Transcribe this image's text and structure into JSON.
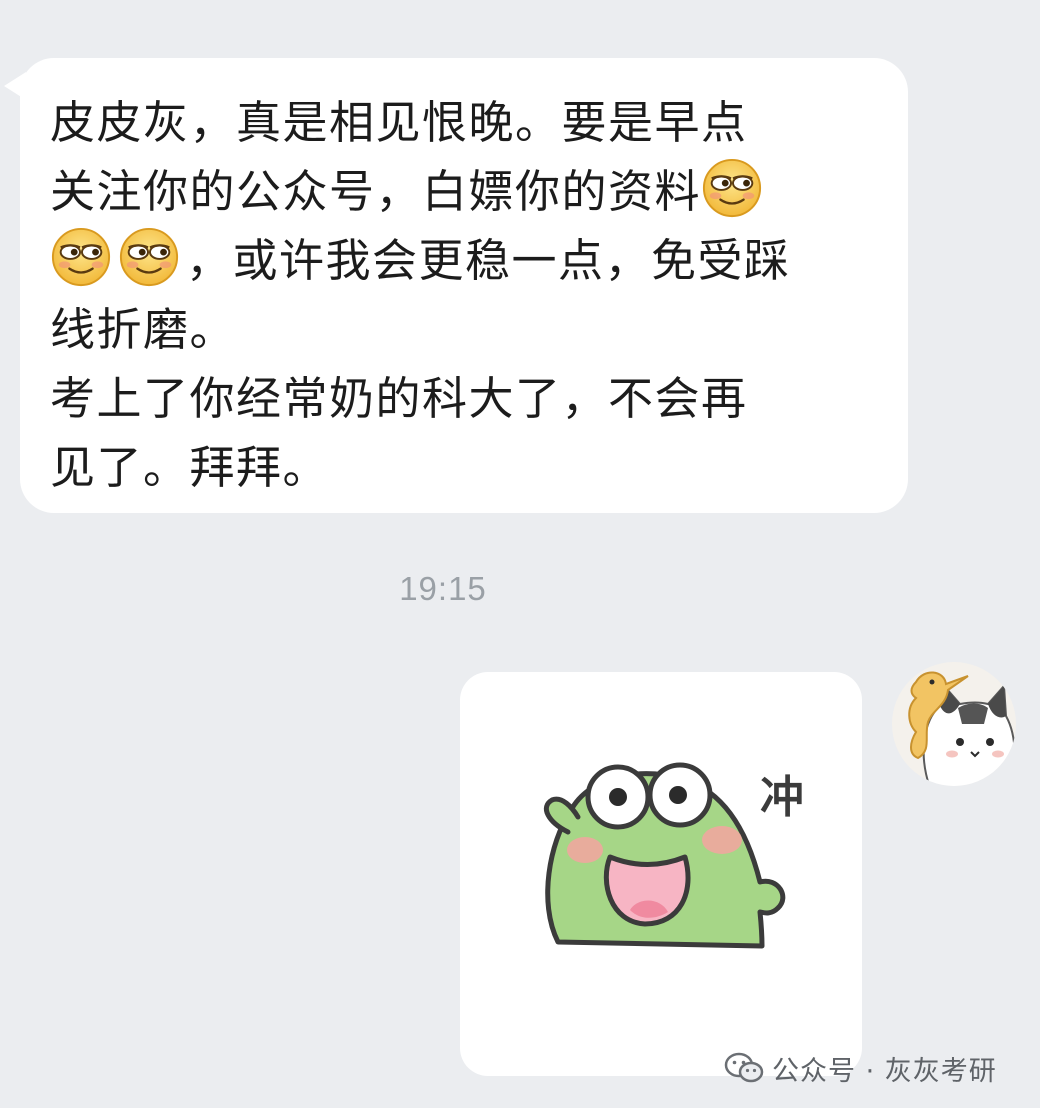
{
  "incoming_message": {
    "lines": [
      "皮皮灰，真是相见恨晚。要是早点",
      "关注你的公众号，白嫖你的资料",
      "，或许我会更稳一点，免受踩",
      "线折磨。",
      "考上了你经常奶的科大了，不会再",
      "见了。拜拜。"
    ],
    "emojis": [
      "smirk-emoji",
      "smirk-emoji",
      "smirk-emoji"
    ]
  },
  "timestamp": "19:15",
  "outgoing_sticker": {
    "caption": "冲",
    "icon": "frog-sticker"
  },
  "avatar": {
    "icon": "cat-avatar"
  },
  "watermark": {
    "text": "公众号 · 灰灰考研",
    "icon": "wechat-logo-icon"
  },
  "colors": {
    "background": "#ebedf0",
    "bubble": "#ffffff",
    "timestamp": "#9aa0a6",
    "frog_green": "#a6d687",
    "emoji_yellow": "#f7cd4b"
  }
}
